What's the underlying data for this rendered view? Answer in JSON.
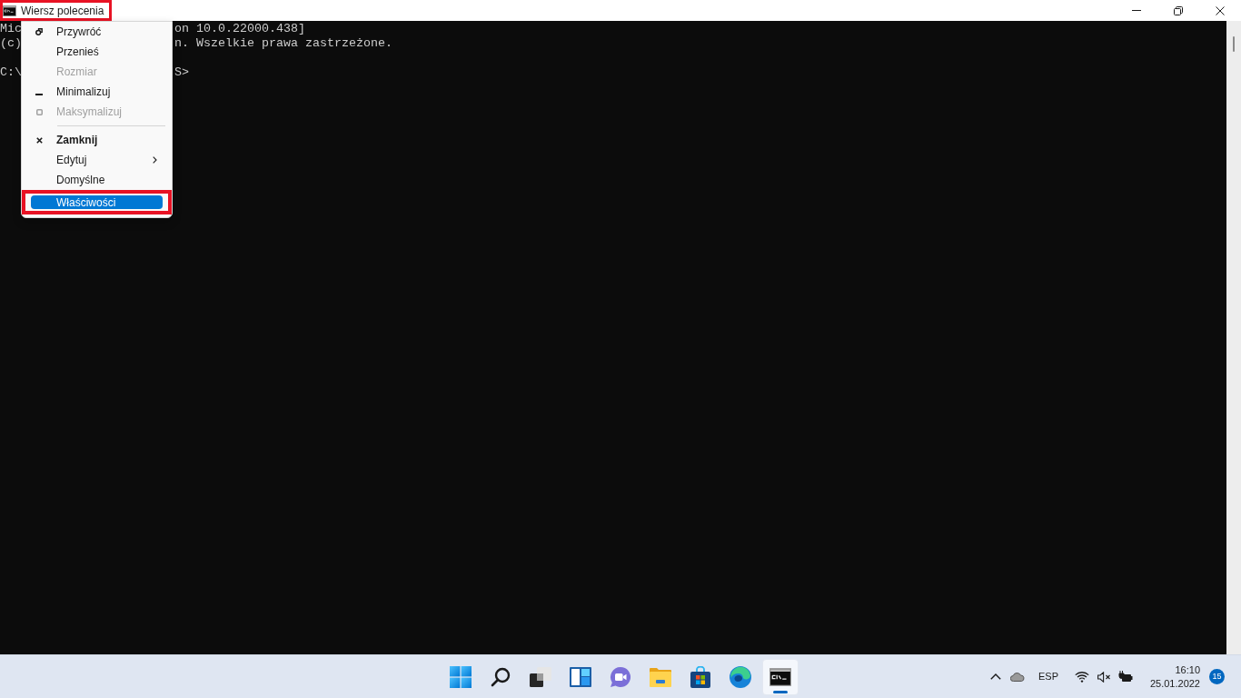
{
  "window": {
    "title": "Wiersz polecenia",
    "highlighted": true
  },
  "terminal": {
    "lines": [
      {
        "kind": "output",
        "left": "Mic",
        "right": "on 10.0.22000.438]"
      },
      {
        "kind": "output",
        "left": "(c)",
        "right": "n. Wszelkie prawa zastrzeżone."
      },
      {
        "kind": "prompt",
        "left": "C:\\",
        "right": "S>"
      }
    ]
  },
  "system_menu": {
    "groups": [
      [
        {
          "label": "Przywróć",
          "kind": "restore",
          "disabled": false,
          "default": false,
          "selected": false,
          "highlighted": false
        },
        {
          "label": "Przenieś",
          "kind": "plain",
          "disabled": false,
          "default": false,
          "selected": false,
          "highlighted": false
        },
        {
          "label": "Rozmiar",
          "kind": "plain",
          "disabled": true,
          "default": false,
          "selected": false,
          "highlighted": false
        },
        {
          "label": "Minimalizuj",
          "kind": "minimize",
          "disabled": false,
          "default": false,
          "selected": false,
          "highlighted": false
        },
        {
          "label": "Maksymalizuj",
          "kind": "maximize",
          "disabled": true,
          "default": false,
          "selected": false,
          "highlighted": false
        }
      ],
      [
        {
          "label": "Zamknij",
          "kind": "close",
          "disabled": false,
          "default": true,
          "selected": false,
          "highlighted": false
        },
        {
          "label": "Edytuj",
          "kind": "submenu",
          "disabled": false,
          "default": false,
          "selected": false,
          "highlighted": false
        },
        {
          "label": "Domyślne",
          "kind": "plain",
          "disabled": false,
          "default": false,
          "selected": false,
          "highlighted": false
        },
        {
          "label": "Właściwości",
          "kind": "plain",
          "disabled": false,
          "default": false,
          "selected": true,
          "highlighted": true
        }
      ]
    ]
  },
  "taskbar": {
    "apps": [
      {
        "kind": "start",
        "selected": false
      },
      {
        "kind": "search",
        "selected": false
      },
      {
        "kind": "taskview",
        "selected": false
      },
      {
        "kind": "widgets",
        "selected": false
      },
      {
        "kind": "chat",
        "selected": false
      },
      {
        "kind": "explorer",
        "selected": false
      },
      {
        "kind": "store",
        "selected": false
      },
      {
        "kind": "browser",
        "selected": false
      },
      {
        "kind": "terminal",
        "selected": true
      }
    ],
    "tray": {
      "language": "ESP",
      "time": "16:10",
      "date": "25.01.2022",
      "notifications": "15"
    }
  }
}
